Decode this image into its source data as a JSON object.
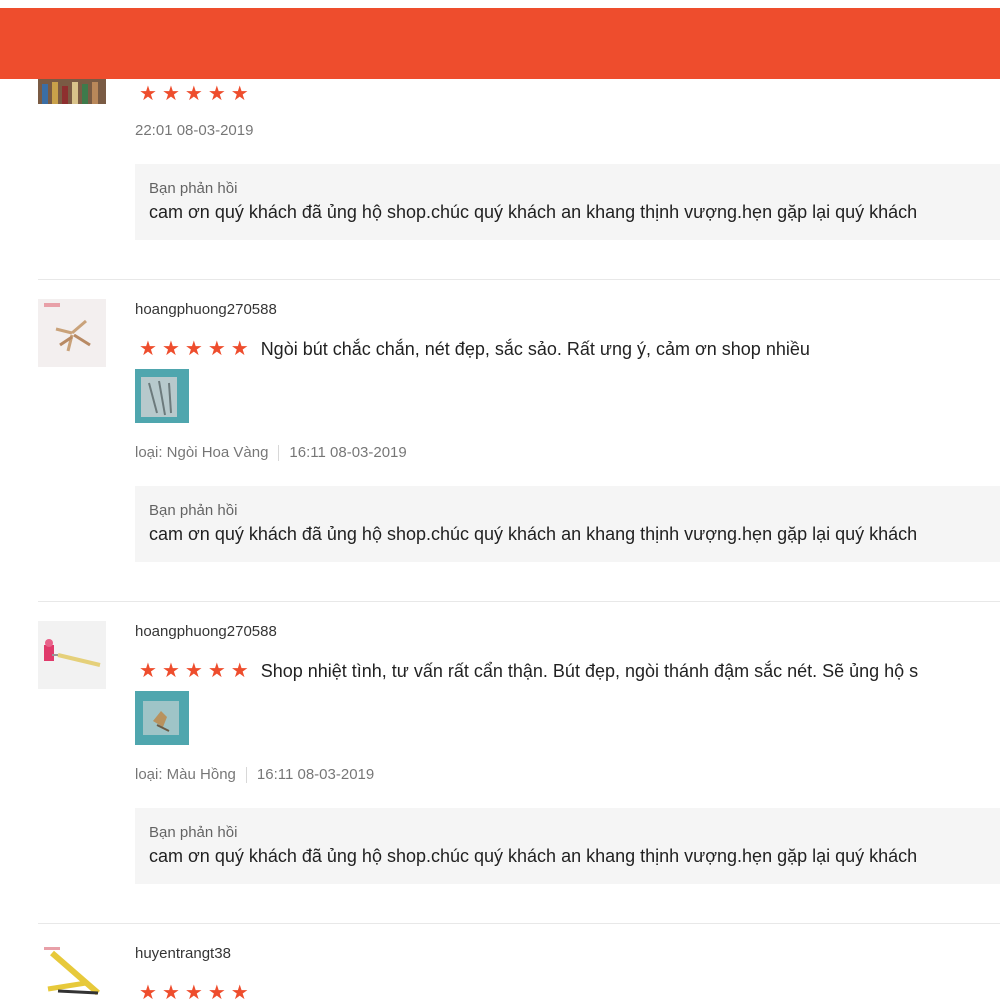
{
  "header": {
    "color": "#ee4d2d"
  },
  "reviews": [
    {
      "username": "",
      "stars": 5,
      "comment": "",
      "meta_date": "22:01 08-03-2019",
      "reply_label": "Bạn phản hồi",
      "reply_text": "cam ơn quý khách đã ủng hộ shop.chúc quý khách an khang thịnh vượng.hẹn gặp lại quý khách"
    },
    {
      "username": "hoangphuong270588",
      "stars": 5,
      "comment": "Ngòi bút chắc chắn, nét đẹp, sắc sảo. Rất ưng ý, cảm ơn shop nhiều",
      "variant": "loại: Ngòi Hoa Vàng",
      "meta_date": "16:11 08-03-2019",
      "reply_label": "Bạn phản hồi",
      "reply_text": "cam ơn quý khách đã ủng hộ shop.chúc quý khách an khang thịnh vượng.hẹn gặp lại quý khách"
    },
    {
      "username": "hoangphuong270588",
      "stars": 5,
      "comment": "Shop nhiệt tình, tư vấn rất cẩn thận. Bút đẹp, ngòi thánh đậm sắc nét. Sẽ ủng hộ s",
      "variant": "loại: Màu Hồng",
      "meta_date": "16:11 08-03-2019",
      "reply_label": "Bạn phản hồi",
      "reply_text": "cam ơn quý khách đã ủng hộ shop.chúc quý khách an khang thịnh vượng.hẹn gặp lại quý khách"
    },
    {
      "username": "huyentrangt38",
      "stars": 5
    }
  ],
  "icons": {
    "star": "star-icon"
  }
}
